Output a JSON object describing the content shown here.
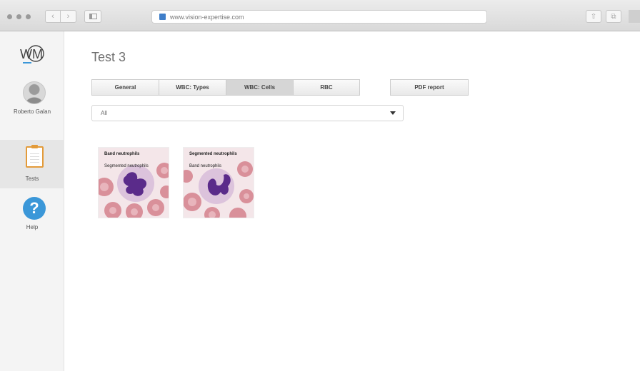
{
  "browser": {
    "url": "www.vision-expertise.com",
    "back_glyph": "‹",
    "forward_glyph": "›",
    "share_glyph": "⇧",
    "tabs_glyph": "⧉"
  },
  "sidebar": {
    "logo_text": "WM",
    "user_name": "Roberto Galan",
    "items": [
      {
        "label": "Tests",
        "icon": "clipboard-icon",
        "active": true
      },
      {
        "label": "Help",
        "icon": "help-icon",
        "active": false
      }
    ],
    "help_glyph": "?"
  },
  "main": {
    "title": "Test 3",
    "tabs": [
      {
        "label": "General",
        "active": false
      },
      {
        "label": "WBC: Types",
        "active": false
      },
      {
        "label": "WBC: Cells",
        "active": true
      },
      {
        "label": "RBC",
        "active": false
      }
    ],
    "pdf_button": "PDF report",
    "filter": {
      "selected": "All"
    },
    "cells": [
      {
        "category": "Band neutrophils",
        "name": "Segmented neutrophils"
      },
      {
        "category": "Segmented neutrophils",
        "name": "Band neutrophils"
      }
    ]
  },
  "colors": {
    "accent_blue": "#3b97d8",
    "clipboard_orange": "#e39b3a",
    "nucleus_purple": "#5a2b8a",
    "rbc_pink": "#d9909a"
  }
}
